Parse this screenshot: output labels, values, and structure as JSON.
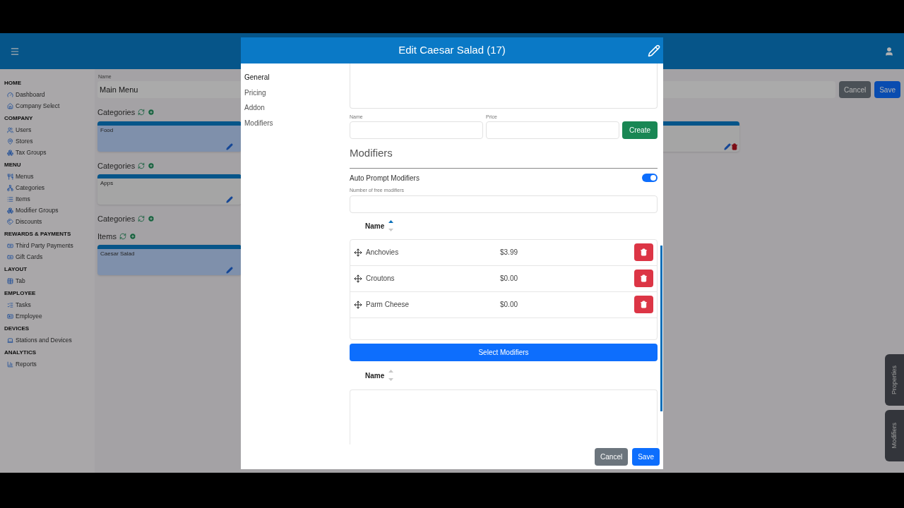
{
  "sidebar": {
    "sections": [
      {
        "title": "HOME",
        "items": [
          {
            "label": "Dashboard"
          },
          {
            "label": "Company Select"
          }
        ]
      },
      {
        "title": "COMPANY",
        "items": [
          {
            "label": "Users"
          },
          {
            "label": "Stores"
          },
          {
            "label": "Tax Groups"
          }
        ]
      },
      {
        "title": "MENU",
        "items": [
          {
            "label": "Menus"
          },
          {
            "label": "Categories"
          },
          {
            "label": "Items"
          },
          {
            "label": "Modifier Groups"
          },
          {
            "label": "Discounts"
          }
        ]
      },
      {
        "title": "REWARDS & PAYMENTS",
        "items": [
          {
            "label": "Third Party Payments"
          },
          {
            "label": "Gift Cards"
          }
        ]
      },
      {
        "title": "LAYOUT",
        "items": [
          {
            "label": "Tab"
          }
        ]
      },
      {
        "title": "EMPLOYEE",
        "items": [
          {
            "label": "Tasks"
          },
          {
            "label": "Employee"
          }
        ]
      },
      {
        "title": "DEVICES",
        "items": [
          {
            "label": "Stations and Devices"
          }
        ]
      },
      {
        "title": "ANALYTICS",
        "items": [
          {
            "label": "Reports"
          }
        ]
      }
    ]
  },
  "main": {
    "name_label": "Name",
    "name_value": "Main Menu",
    "buttons": [
      "Cancel",
      "Save"
    ],
    "groups": [
      {
        "title": "Categories",
        "cards": [
          {
            "label": "Food",
            "selected": true
          },
          {
            "selected": false
          }
        ]
      },
      {
        "title": "Categories",
        "cards": [
          {
            "label": "Apps",
            "selected": false
          }
        ]
      },
      {
        "title": "Categories"
      },
      {
        "title": "Items",
        "cards": [
          {
            "label": "Caesar Salad",
            "selected": true
          }
        ]
      }
    ]
  },
  "side_tabs": [
    "Properties",
    "Modifiers"
  ],
  "modal": {
    "title": "Edit Caesar Salad (17)",
    "nav": [
      {
        "label": "General",
        "selected": true
      },
      {
        "label": "Pricing",
        "selected": false
      },
      {
        "label": "Addon",
        "selected": false
      },
      {
        "label": "Modifiers",
        "selected": false
      }
    ],
    "name_label": "Name",
    "price_label": "Price",
    "create_button": "Create",
    "section_title": "Modifiers",
    "auto_prompt": {
      "label": "Auto Prompt Modifiers",
      "on": true
    },
    "free_label": "Number of free modifiers",
    "table1": {
      "column": "Name",
      "sorted": true,
      "rows": [
        {
          "name": "Anchovies",
          "price": "$3.99"
        },
        {
          "name": "Croutons",
          "price": "$0.00"
        },
        {
          "name": "Parm Cheese",
          "price": "$0.00"
        }
      ]
    },
    "select_button": "Select Modifiers",
    "table2": {
      "column": "Name",
      "sorted": false
    },
    "footer": [
      "Cancel",
      "Save"
    ]
  }
}
